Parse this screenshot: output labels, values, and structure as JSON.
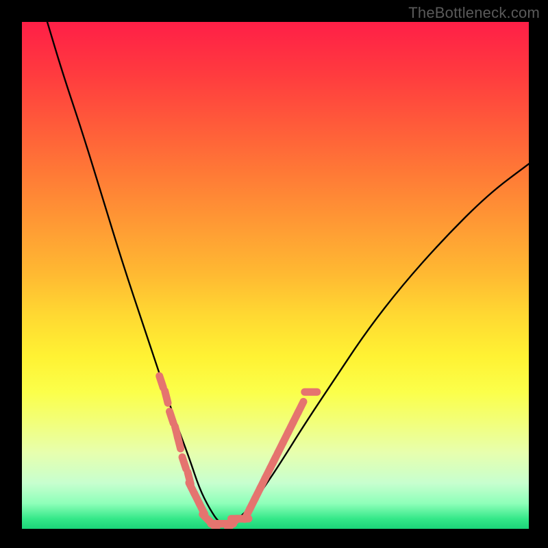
{
  "watermark": "TheBottleneck.com",
  "chart_data": {
    "type": "line",
    "title": "",
    "xlabel": "",
    "ylabel": "",
    "xlim": [
      0,
      100
    ],
    "ylim": [
      0,
      100
    ],
    "grid": false,
    "series": [
      {
        "name": "bottleneck-curve",
        "color": "#000000",
        "x": [
          5,
          8,
          12,
          16,
          20,
          24,
          27,
          30,
          33,
          35,
          37,
          39,
          41,
          44,
          47,
          51,
          56,
          62,
          68,
          75,
          83,
          92,
          100
        ],
        "y": [
          100,
          90,
          78,
          65,
          52,
          40,
          31,
          22,
          14,
          8,
          4,
          1,
          1,
          3,
          7,
          13,
          21,
          30,
          39,
          48,
          57,
          66,
          72
        ]
      },
      {
        "name": "marker-cluster-left",
        "type": "scatter",
        "color": "#e5746f",
        "x": [
          27.5,
          28.5,
          29.5,
          30.5,
          31,
          32,
          33,
          33.5,
          34.5,
          35.5,
          36.5,
          37.5
        ],
        "y": [
          29,
          26,
          22,
          19,
          17,
          13,
          10,
          8,
          6,
          4,
          2,
          1
        ]
      },
      {
        "name": "marker-cluster-bottom",
        "type": "scatter",
        "color": "#e5746f",
        "x": [
          38.5,
          39.5,
          40.5,
          41.5,
          42.5,
          43.5
        ],
        "y": [
          1,
          1,
          1,
          1,
          2,
          2
        ]
      },
      {
        "name": "marker-cluster-right",
        "type": "scatter",
        "color": "#e5746f",
        "x": [
          44.5,
          45.5,
          46.5,
          47.5,
          48.5,
          49.5,
          50,
          51,
          52,
          53,
          54,
          55
        ],
        "y": [
          3,
          5,
          7,
          9,
          11,
          13,
          14,
          16,
          18,
          20,
          22,
          24
        ]
      },
      {
        "name": "marker-right-isolated",
        "type": "scatter",
        "color": "#e5746f",
        "x": [
          57
        ],
        "y": [
          27
        ]
      }
    ],
    "gradient_bands": [
      {
        "y_from": 100,
        "y_to": 70,
        "color_start": "#ff1f47",
        "color_end": "#ff7a36"
      },
      {
        "y_from": 70,
        "y_to": 35,
        "color_start": "#ff7a36",
        "color_end": "#fff233"
      },
      {
        "y_from": 35,
        "y_to": 10,
        "color_start": "#fff233",
        "color_end": "#e7ffae"
      },
      {
        "y_from": 10,
        "y_to": 0,
        "color_start": "#e7ffae",
        "color_end": "#1bd478"
      }
    ]
  }
}
